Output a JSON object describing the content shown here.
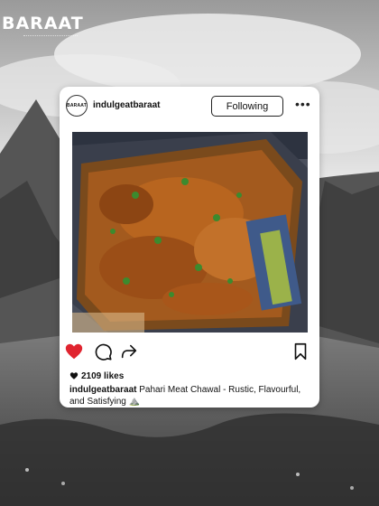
{
  "brand": {
    "name": "BARAAT"
  },
  "post": {
    "avatar_label": "BARAAT",
    "username": "indulgeatbaraat",
    "follow_label": "Following",
    "more_label": "•••",
    "image_description": "Pahari Meat Chawal dish in a tray",
    "likes": "2109 likes",
    "caption_user": "indulgeatbaraat",
    "caption_text": "Pahari Meat Chawal - Rustic, Flavourful, and Satisfying",
    "caption_emoji": "⛰️",
    "liked": true
  },
  "colors": {
    "like_red": "#e0242f",
    "text": "#111111"
  }
}
